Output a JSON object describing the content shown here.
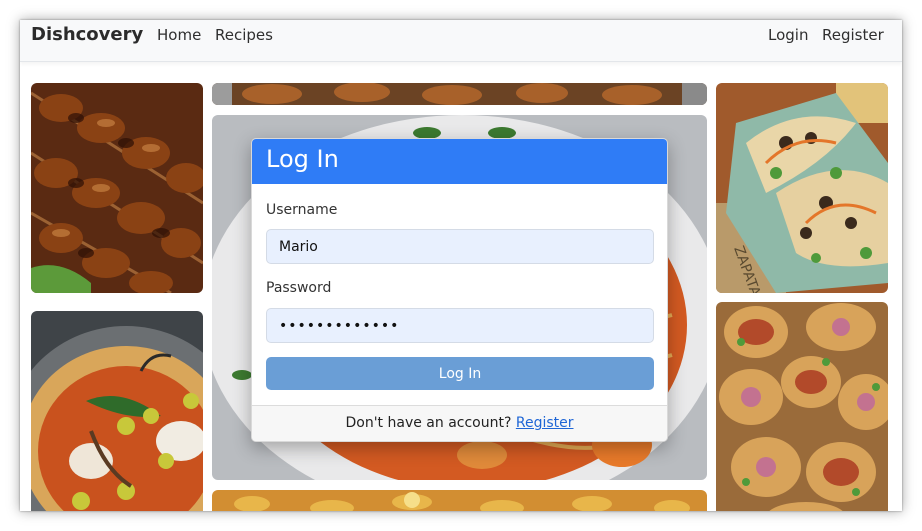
{
  "navbar": {
    "brand": "Dishcovery",
    "links": {
      "home": "Home",
      "recipes": "Recipes",
      "login": "Login",
      "register": "Register"
    }
  },
  "login_form": {
    "title": "Log In",
    "username_label": "Username",
    "username_value": "Mario",
    "password_label": "Password",
    "password_value": "•••••••••••••",
    "submit_label": "Log In",
    "footer_text": "Don't have an account?",
    "footer_link": "Register"
  },
  "colors": {
    "header_blue": "#2f7cf6",
    "button_blue": "#6a9ed6",
    "input_bg": "#e8f0fe",
    "link_blue": "#1f66d6"
  },
  "background_photos": [
    "grilled-skewers",
    "pizza",
    "pasta",
    "tacos",
    "pani-puri"
  ]
}
